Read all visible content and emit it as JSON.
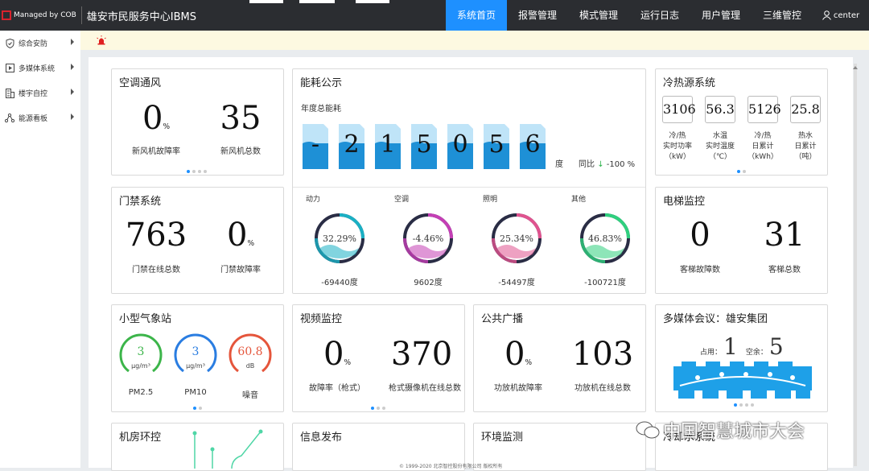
{
  "header": {
    "managed": "Managed by COB",
    "title": "雄安市民服务中心IBMS",
    "nav": [
      "系统首页",
      "报警管理",
      "模式管理",
      "运行日志",
      "用户管理",
      "三维管控"
    ],
    "user": "center"
  },
  "sidebar": {
    "items": [
      "综合安防",
      "多媒体系统",
      "楼宇自控",
      "能源看板"
    ]
  },
  "hvac": {
    "title": "空调通风",
    "v1": "0",
    "u1": "%",
    "l1": "新风机故障率",
    "v2": "35",
    "l2": "新风机总数"
  },
  "energy": {
    "title": "能耗公示",
    "subtitle": "年度总能耗",
    "digits": [
      "-",
      "2",
      "1",
      "5",
      "0",
      "5",
      "6"
    ],
    "unit": "度",
    "yoy_label": "同比",
    "yoy_arrow": "↓",
    "yoy_value": "-100 %",
    "gauges": [
      {
        "name": "动力",
        "pct": "32.29%",
        "val": "-69440度",
        "color": "#1ab0c4"
      },
      {
        "name": "空调",
        "pct": "-4.46%",
        "val": "9602度",
        "color": "#c43fb5"
      },
      {
        "name": "照明",
        "pct": "25.34%",
        "val": "-54497度",
        "color": "#e0538f"
      },
      {
        "name": "其他",
        "pct": "46.83%",
        "val": "-100721度",
        "color": "#2fd07e"
      }
    ]
  },
  "cold": {
    "title": "冷热源系统",
    "vals": [
      "3106",
      "56.3",
      "5126",
      "25.8"
    ],
    "labels": [
      [
        "冷/热",
        "实时功率",
        "（kW）"
      ],
      [
        "水温",
        "实时温度",
        "（℃）"
      ],
      [
        "冷/热",
        "日累计",
        "（kWh）"
      ],
      [
        "热水",
        "日累计",
        "（吨）"
      ]
    ]
  },
  "door": {
    "title": "门禁系统",
    "v1": "763",
    "l1": "门禁在线总数",
    "v2": "0",
    "u2": "%",
    "l2": "门禁故障率"
  },
  "elevator": {
    "title": "电梯监控",
    "v1": "0",
    "l1": "客梯故障数",
    "v2": "31",
    "l2": "客梯总数"
  },
  "weather": {
    "title": "小型气象站",
    "items": [
      {
        "v": "3",
        "u": "μg/m³",
        "n": "PM2.5",
        "color": "#3cb54a"
      },
      {
        "v": "3",
        "u": "μg/m³",
        "n": "PM10",
        "color": "#2a7de1"
      },
      {
        "v": "60.8",
        "u": "dB",
        "n": "噪音",
        "color": "#e5553b"
      }
    ]
  },
  "video": {
    "title": "视频监控",
    "v1": "0",
    "u1": "%",
    "l1": "故障率（枪式）",
    "v2": "370",
    "l2": "枪式摄像机在线总数"
  },
  "broadcast": {
    "title": "公共广播",
    "v1": "0",
    "u1": "%",
    "l1": "功放机故障率",
    "v2": "103",
    "l2": "功放机在线总数"
  },
  "meeting": {
    "title": "多媒体会议：雄安集团",
    "occ_label": "占用：",
    "occ": "1",
    "free_label": "空余：",
    "free": "5"
  },
  "row4": {
    "t1": "机房环控",
    "t2": "信息发布",
    "t3": "环境监测",
    "t4": "冷却水系统"
  },
  "watermark": "中国智慧城市大会",
  "footer": "© 1999-2020 北京智控股份有限公司 版权所有"
}
